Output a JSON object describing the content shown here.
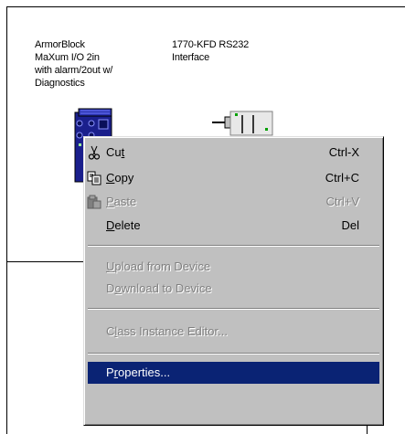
{
  "devices": [
    {
      "label_lines": [
        "ArmorBlock",
        "MaXum I/O  2in",
        "with alarm/2out w/",
        "Diagnostics"
      ]
    },
    {
      "label_lines": [
        "1770-KFD RS232",
        "Interface"
      ]
    }
  ],
  "context_menu": {
    "items": [
      {
        "pre": "Cu",
        "key": "t",
        "post": "",
        "shortcut": "Ctrl-X",
        "enabled": true,
        "icon": "cut-icon"
      },
      {
        "pre": "",
        "key": "C",
        "post": "opy",
        "shortcut": "Ctrl+C",
        "enabled": true,
        "icon": "copy-icon"
      },
      {
        "pre": "",
        "key": "P",
        "post": "aste",
        "shortcut": "Ctrl+V",
        "enabled": false,
        "icon": "paste-icon"
      },
      {
        "pre": "",
        "key": "D",
        "post": "elete",
        "shortcut": "Del",
        "enabled": true
      },
      {
        "pre": "",
        "key": "U",
        "post": "pload from Device",
        "enabled": false
      },
      {
        "pre": "D",
        "key": "o",
        "post": "wnload to Device",
        "enabled": false
      },
      {
        "pre": "C",
        "key": "l",
        "post": "ass Instance Editor...",
        "enabled": false
      },
      {
        "pre": "P",
        "key": "r",
        "post": "operties...",
        "enabled": true,
        "selected": true
      }
    ]
  },
  "colors": {
    "selection": "#0a2374",
    "menu_face": "#c0c0c0",
    "device_blue": "#1a1f8c"
  }
}
